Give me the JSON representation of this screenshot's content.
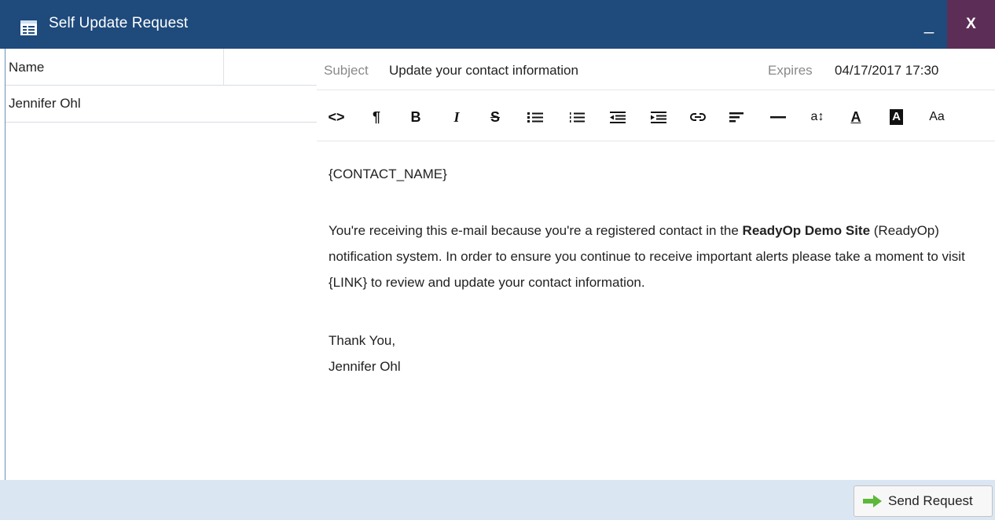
{
  "window": {
    "title": "Self Update Request",
    "minimize_label": "_",
    "close_label": "X"
  },
  "list": {
    "column_name": "Name",
    "rows": [
      "Jennifer Ohl"
    ]
  },
  "email": {
    "subject_label": "Subject",
    "subject_value": "Update your contact information",
    "expires_label": "Expires",
    "expires_value": "04/17/2017 17:30",
    "greeting": "{CONTACT_NAME}",
    "body_part1": "You're receiving this e-mail because you're a registered contact in the ",
    "body_bold": "ReadyOp Demo Site",
    "body_part2": " (ReadyOp) notification system. In order to ensure you continue to receive important alerts please take a moment to visit {LINK} to review and update your contact information.",
    "signoff": "Thank You,",
    "signature": "Jennifer Ohl"
  },
  "toolbar": {
    "html": "<>",
    "paragraph": "¶",
    "bold": "B",
    "italic": "I",
    "strike": "S",
    "font_size": "a↕",
    "font_color": "A",
    "bg_color": "A",
    "font_family": "Aa"
  },
  "footer": {
    "send_label": "Send Request"
  },
  "colors": {
    "titlebar": "#1e4a7c",
    "close_button": "#5c2e57",
    "footer": "#dbe6f3",
    "send_arrow": "#5cb83a"
  }
}
